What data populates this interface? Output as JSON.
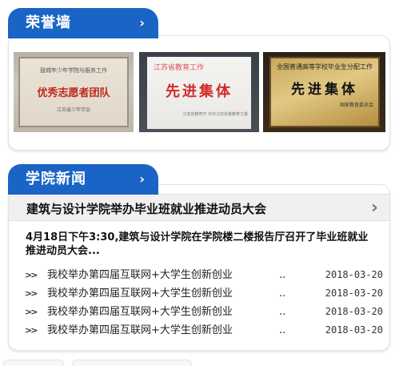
{
  "honor": {
    "tab_label": "荣誉墙",
    "chevron": "›",
    "photos": [
      {
        "org": "鼓城年少年学院与服务工作",
        "main": "优秀志愿者团队",
        "sign": "江苏省少年学会"
      },
      {
        "org": "江苏省教育工作",
        "main": "先进集体",
        "sign": "江苏省教育厅 中共江苏省委教育工委"
      },
      {
        "org": "全国普通高等学校毕业生分配工作",
        "main": "先进集体",
        "sign": "国家教育委员会"
      }
    ]
  },
  "news": {
    "tab_label": "学院新闻",
    "chevron": "›",
    "headline": "建筑与设计学院举办毕业班就业推进动员大会",
    "headline_arrow": "›",
    "summary": "4月18日下午3:30,建筑与设计学院在学院楼二楼报告厅召开了毕业班就业推进动员大会...",
    "items": [
      {
        "bullet": ">>",
        "title": "我校举办第四届互联网+大学生创新创业",
        "dots": "..",
        "date": "2018-03-20"
      },
      {
        "bullet": ">>",
        "title": "我校举办第四届互联网+大学生创新创业",
        "dots": "..",
        "date": "2018-03-20"
      },
      {
        "bullet": ">>",
        "title": "我校举办第四届互联网+大学生创新创业",
        "dots": "..",
        "date": "2018-03-20"
      },
      {
        "bullet": ">>",
        "title": "我校举办第四届互联网+大学生创新创业",
        "dots": "..",
        "date": "2018-03-20"
      }
    ]
  },
  "colors": {
    "tab_blue": "#1a64c6",
    "headline_bg": "#f0f0f0"
  }
}
